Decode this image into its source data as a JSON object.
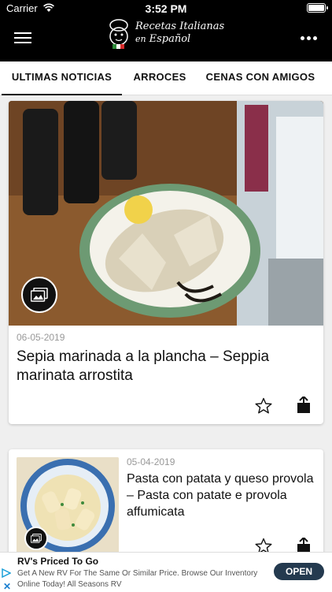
{
  "status_bar": {
    "carrier": "Carrier",
    "time": "3:52 PM"
  },
  "header": {
    "logo_line1": "Recetas Italianas",
    "logo_line2_small": "en",
    "logo_line2": "Español",
    "colors": {
      "background": "#000000",
      "foreground": "#ffffff"
    }
  },
  "tabs": [
    {
      "label": "ULTIMAS NOTICIAS",
      "active": true
    },
    {
      "label": "ARROCES",
      "active": false
    },
    {
      "label": "CENAS CON AMIGOS",
      "active": false
    }
  ],
  "articles": [
    {
      "date": "06-05-2019",
      "title": "Sepia marinada a la plancha – Seppia marinata arrostita"
    },
    {
      "date": "05-04-2019",
      "title": "Pasta con patata y queso provola – Pasta con patate e provola affumicata"
    }
  ],
  "ad": {
    "title": "RV's Priced To Go",
    "body": "Get A New RV For The Same Or Similar Price. Browse Our Inventory Online Today! All Seasons RV",
    "cta": "OPEN",
    "cta_color": "#243a4f"
  }
}
